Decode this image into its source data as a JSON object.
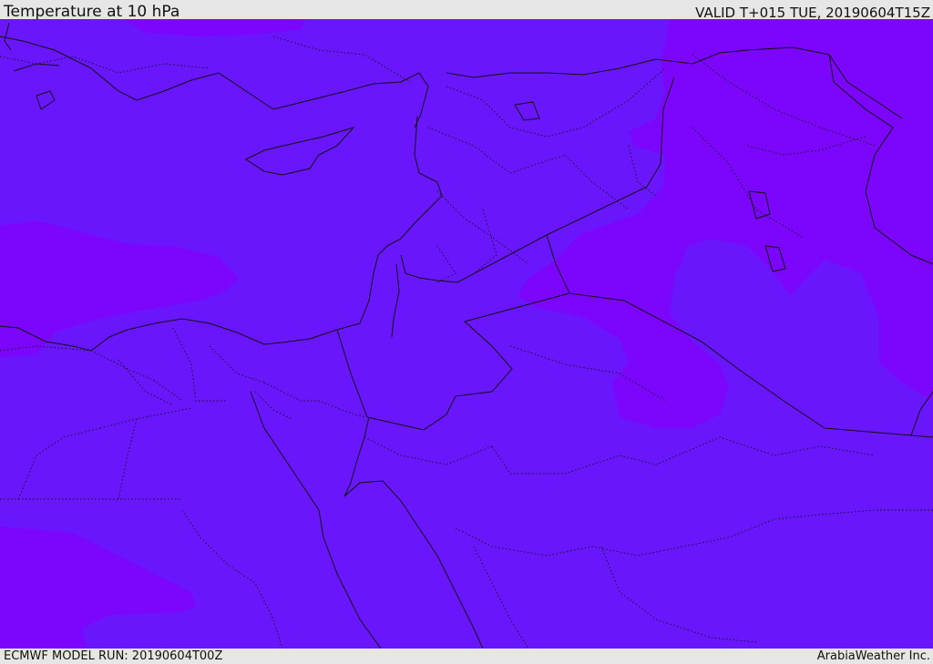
{
  "header": {
    "title": "Temperature at 10 hPa",
    "valid_time": "VALID T+015 TUE, 20190604T15Z"
  },
  "footer": {
    "model_run": "ECMWF MODEL RUN: 20190604T00Z",
    "credit": "ArabiaWeather Inc."
  },
  "map": {
    "region": "Eastern Mediterranean / Levant / Iraq / Northern Arabia",
    "field": "temperature",
    "colors": {
      "base_fill": "#6a16fc",
      "warm_fill": "#7c06fb",
      "coastline": "#111111",
      "border": "#111111"
    }
  }
}
